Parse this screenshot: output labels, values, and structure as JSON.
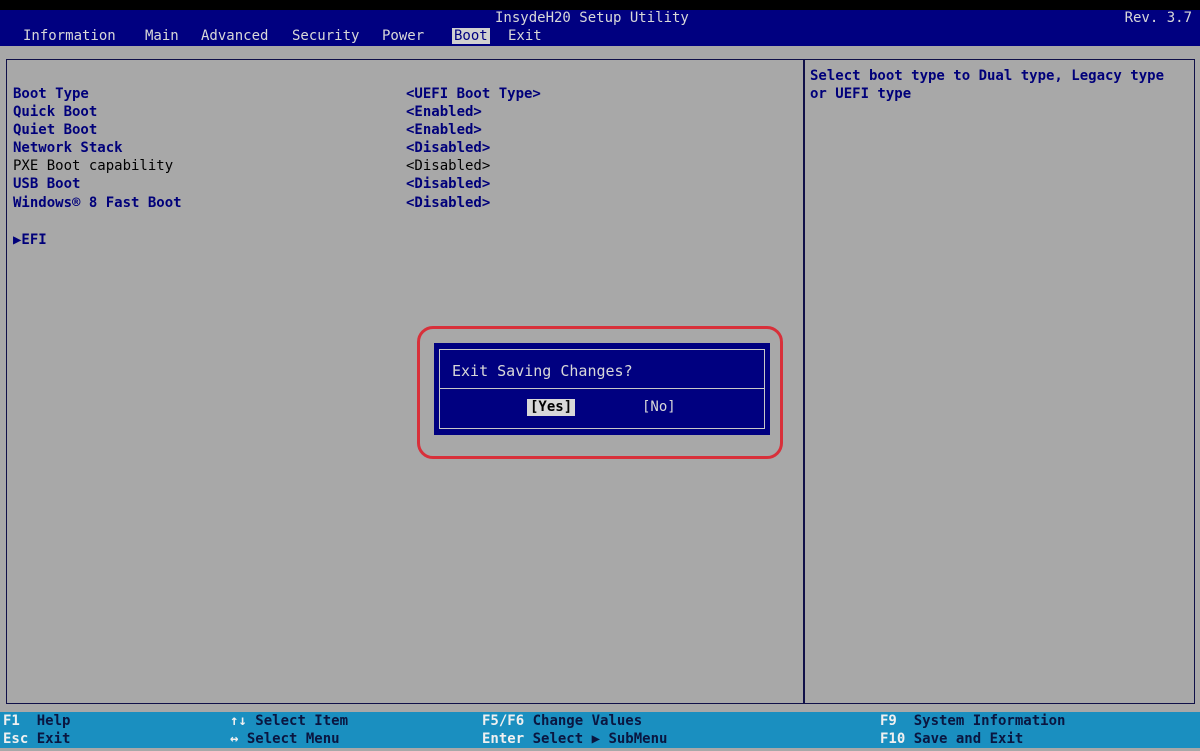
{
  "header": {
    "title": "InsydeH20 Setup Utility",
    "revision": "Rev. 3.7"
  },
  "menu": {
    "items": [
      "Information",
      "Main",
      "Advanced",
      "Security",
      "Power",
      "Boot",
      "Exit"
    ],
    "active": "Boot"
  },
  "options": [
    {
      "label": "Boot Type",
      "value": "<UEFI Boot Type>"
    },
    {
      "label": "Quick Boot",
      "value": "<Enabled>"
    },
    {
      "label": "Quiet Boot",
      "value": "<Enabled>"
    },
    {
      "label": "Network Stack",
      "value": "<Disabled>"
    },
    {
      "label": "PXE Boot capability",
      "value": "<Disabled>"
    },
    {
      "label": "USB Boot",
      "value": "<Disabled>"
    },
    {
      "label": "Windows® 8 Fast Boot",
      "value": "<Disabled>"
    }
  ],
  "submenu": {
    "label": "▶EFI"
  },
  "help": {
    "text": "Select boot type to Dual type, Legacy type or UEFI type"
  },
  "dialog": {
    "title": "Exit Saving Changes?",
    "yes_label": "[Yes]",
    "no_label": "[No]"
  },
  "footer": {
    "help_key": "F1",
    "help_desc": "Help",
    "exit_key": "Esc",
    "exit_desc": "Exit",
    "select_item_key": "↑↓",
    "select_item_desc": "Select Item",
    "select_menu_key": "↔",
    "select_menu_desc": "Select Menu",
    "change_key": "F5/F6",
    "change_desc": "Change Values",
    "enter_key": "Enter",
    "enter_desc": "Select ▶ SubMenu",
    "f9_key": "F9",
    "f9_desc": "System Information",
    "f10_key": "F10",
    "f10_desc": "Save and Exit"
  },
  "colors": {
    "background": "#a8a8a8",
    "title_bar": "#000080",
    "footer": "#1a8fc0",
    "highlight_ring": "#d8303a"
  }
}
